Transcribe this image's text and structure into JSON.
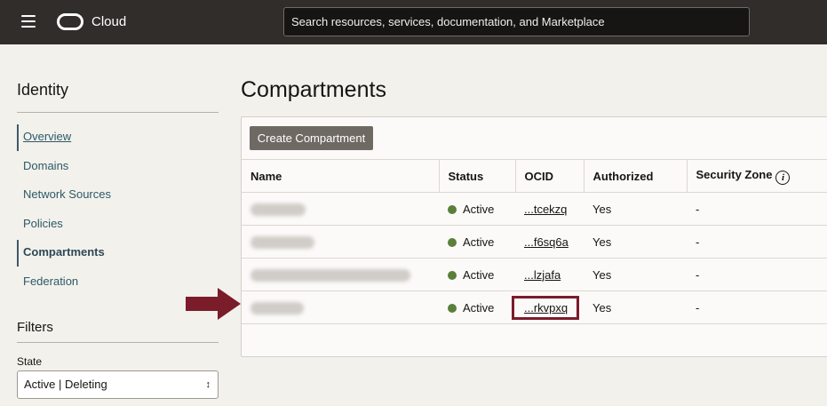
{
  "header": {
    "brand": "Cloud",
    "search_placeholder": "Search resources, services, documentation, and Marketplace"
  },
  "sidebar": {
    "title": "Identity",
    "items": [
      {
        "label": "Overview"
      },
      {
        "label": "Domains"
      },
      {
        "label": "Network Sources"
      },
      {
        "label": "Policies"
      },
      {
        "label": "Compartments"
      },
      {
        "label": "Federation"
      }
    ],
    "filters_title": "Filters",
    "state_label": "State",
    "state_value": "Active | Deleting"
  },
  "main": {
    "title": "Compartments",
    "create_button": "Create Compartment",
    "columns": [
      "Name",
      "Status",
      "OCID",
      "Authorized",
      "Security Zone"
    ],
    "rows": [
      {
        "status": "Active",
        "ocid": "...tcekzq",
        "authorized": "Yes",
        "security_zone": "-"
      },
      {
        "status": "Active",
        "ocid": "...f6sq6a",
        "authorized": "Yes",
        "security_zone": "-"
      },
      {
        "status": "Active",
        "ocid": "...lzjafa",
        "authorized": "Yes",
        "security_zone": "-"
      },
      {
        "status": "Active",
        "ocid": "...rkvpxq",
        "authorized": "Yes",
        "security_zone": "-"
      }
    ]
  },
  "colors": {
    "topbar": "#312d2a",
    "accent_annotation": "#7a1c2a",
    "status_active": "#5a7f3a",
    "button_bg": "#6f6964"
  },
  "icons": [
    "hamburger-menu-icon",
    "oracle-logo-icon",
    "info-icon",
    "chevron-updown-icon",
    "annotation-arrow-icon"
  ]
}
